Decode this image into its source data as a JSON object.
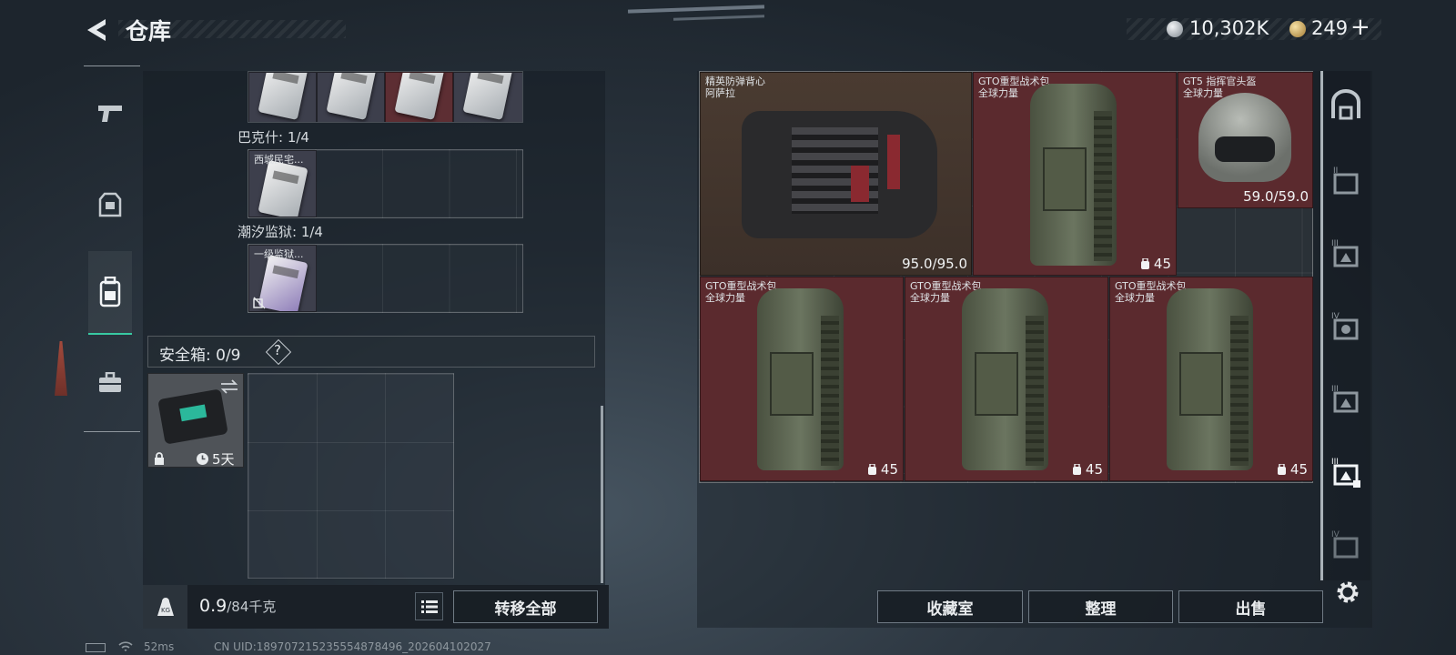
{
  "header": {
    "title": "仓库",
    "currency1": "10,302K",
    "currency2": "249",
    "plus": "+"
  },
  "sections": [
    {
      "label": "巴克什: 1/4",
      "item_name": "西城民宅..."
    },
    {
      "label": "潮汐监狱: 1/4",
      "item_name": "一级监狱..."
    }
  ],
  "safebox": {
    "label": "安全箱: 0/9",
    "help": "?",
    "timer": "5天"
  },
  "footer": {
    "weight_value": "0.9",
    "weight_cap": "/84千克",
    "transfer_all": "转移全部",
    "kg_icon_text": "KG"
  },
  "stash_items": [
    {
      "name": "精英防弹背心",
      "sub": "阿萨拉",
      "value": "95.0/95.0"
    },
    {
      "name": "GTO重型战术包",
      "sub": "全球力量",
      "value": "45"
    },
    {
      "name": "GT5 指挥官头盔",
      "sub": "全球力量",
      "value": "59.0/59.0"
    },
    {
      "name": "GTO重型战术包",
      "sub": "全球力量",
      "value": "45"
    },
    {
      "name": "GTO重型战术包",
      "sub": "全球力量",
      "value": "45"
    },
    {
      "name": "GTO重型战术包",
      "sub": "全球力量",
      "value": "45"
    }
  ],
  "buttons": {
    "collection": "收藏室",
    "sort": "整理",
    "sell": "出售"
  },
  "status": {
    "ping": "52ms",
    "uid": "CN UID:1897072152355548784​96_202604102027"
  },
  "right_icons": [
    "home-icon",
    "tier-ii-icon",
    "tier-iii-icon",
    "tier-iv-icon",
    "tier-iii-alt-icon",
    "tier-active-icon",
    "tier-iv-alt-icon"
  ],
  "left_icons": [
    "pistol-icon",
    "armor-icon",
    "backpack-icon",
    "case-icon"
  ]
}
